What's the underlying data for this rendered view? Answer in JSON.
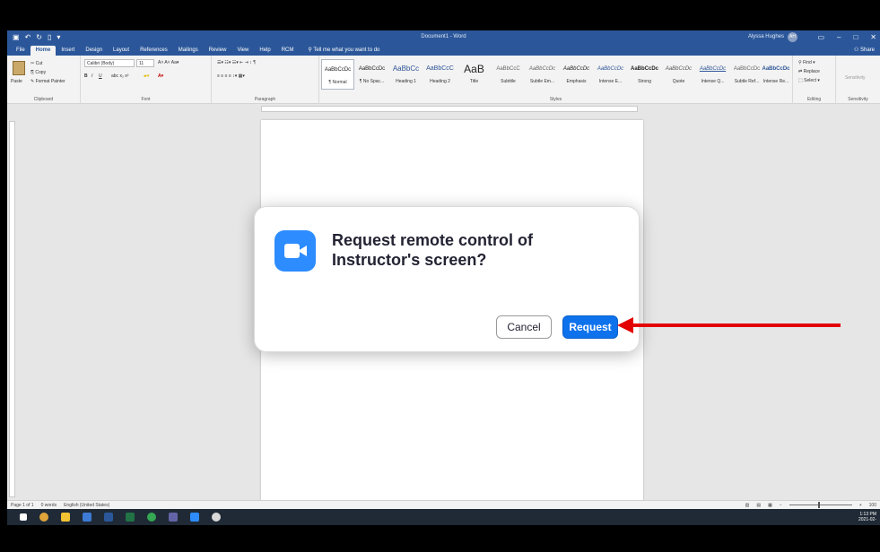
{
  "window": {
    "title": "Document1 - Word",
    "user_name": "Alyssa Hughes",
    "user_initials": "AH"
  },
  "ribbon_tabs": [
    "File",
    "Home",
    "Insert",
    "Design",
    "Layout",
    "References",
    "Mailings",
    "Review",
    "View",
    "Help",
    "RCM"
  ],
  "tell_me": "Tell me what you want to do",
  "share_label": "Share",
  "ribbon": {
    "clipboard": {
      "paste": "Paste",
      "cut": "Cut",
      "copy": "Copy",
      "format_painter": "Format Painter",
      "label": "Clipboard"
    },
    "font": {
      "font_name": "Calibri (Body)",
      "font_size": "11",
      "label": "Font"
    },
    "paragraph_label": "Paragraph",
    "styles": {
      "label": "Styles",
      "items": [
        {
          "sample": "AaBbCcDc",
          "name": "¶ Normal"
        },
        {
          "sample": "AaBbCcDc",
          "name": "¶ No Spac..."
        },
        {
          "sample": "AaBbCc",
          "name": "Heading 1"
        },
        {
          "sample": "AaBbCcC",
          "name": "Heading 2"
        },
        {
          "sample": "AaB",
          "name": "Title"
        },
        {
          "sample": "AaBbCcC",
          "name": "Subtitle"
        },
        {
          "sample": "AaBbCcDc",
          "name": "Subtle Em..."
        },
        {
          "sample": "AaBbCcDc",
          "name": "Emphasis"
        },
        {
          "sample": "AaBbCcDc",
          "name": "Intense E..."
        },
        {
          "sample": "AaBbCcDc",
          "name": "Strong"
        },
        {
          "sample": "AaBbCcDc",
          "name": "Quote"
        },
        {
          "sample": "AaBbCcDc",
          "name": "Intense Q..."
        },
        {
          "sample": "AaBbCcDc",
          "name": "Subtle Ref..."
        },
        {
          "sample": "AaBbCcDc",
          "name": "Intense Re..."
        }
      ]
    },
    "editing": {
      "find": "Find",
      "replace": "Replace",
      "select": "Select",
      "label": "Editing"
    },
    "sensitivity": {
      "button": "Sensitivity",
      "label": "Sensitivity"
    }
  },
  "statusbar": {
    "page": "Page 1 of 1",
    "words": "0 words",
    "language": "English (United States)",
    "zoom": "100"
  },
  "taskbar": {
    "time": "1:13 PM",
    "date": "2021-02-"
  },
  "dialog": {
    "title": "Request remote control of Instructor's screen?",
    "cancel_label": "Cancel",
    "request_label": "Request"
  },
  "colors": {
    "word_blue": "#2b579a",
    "zoom_blue": "#2d8cff",
    "request_button": "#0e72ed",
    "annotation_arrow": "#e30000"
  }
}
